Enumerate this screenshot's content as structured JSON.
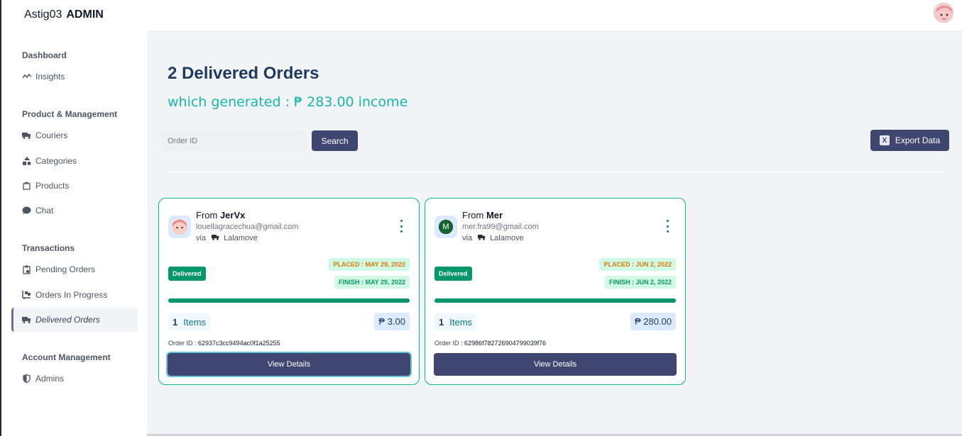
{
  "brand": {
    "name": "Astig03",
    "suffix": "ADMIN"
  },
  "sidebar": {
    "sections": [
      {
        "title": "Dashboard"
      },
      {
        "title": "Product & Management"
      },
      {
        "title": "Transactions"
      },
      {
        "title": "Account Management"
      }
    ],
    "items": [
      {
        "label": "Insights",
        "icon": "chart-line-icon"
      },
      {
        "label": "Couriers",
        "icon": "truck-icon"
      },
      {
        "label": "Categories",
        "icon": "shapes-icon"
      },
      {
        "label": "Products",
        "icon": "bag-icon"
      },
      {
        "label": "Chat",
        "icon": "chat-bubble-icon"
      },
      {
        "label": "Pending Orders",
        "icon": "clipboard-icon"
      },
      {
        "label": "Orders In Progress",
        "icon": "dolly-icon"
      },
      {
        "label": "Delivered Orders",
        "icon": "truck-icon",
        "active": true
      },
      {
        "label": "Admins",
        "icon": "shield-icon"
      }
    ]
  },
  "main": {
    "title": "2 Delivered Orders",
    "income_prefix": "which generated : ",
    "income_amount": "₱ 283.00",
    "income_suffix": " income",
    "search_placeholder": "Order ID",
    "search_label": "Search",
    "export_label": "Export Data"
  },
  "orders": [
    {
      "from_label": "From ",
      "name": "JerVx",
      "email": "louellagracechua@gmail.com",
      "via_label": "via",
      "courier": "Lalamove",
      "status": "Delivered",
      "placed": "PLACED : MAY 29, 2022",
      "finish": "FINISH : MAY 29, 2022",
      "progress": 1.0,
      "item_count": "1",
      "items_label": "Items",
      "price": "₱ 3.00",
      "order_id_label": "Order ID : ",
      "order_id": "62937c3cc9494ac0f1a25255",
      "view_label": "View Details"
    },
    {
      "from_label": "From ",
      "name": "Mer",
      "initial": "M",
      "email": "mer.fra99@gmail.com",
      "via_label": "via",
      "courier": "Lalamove",
      "status": "Delivered",
      "placed": "PLACED : JUN 2, 2022",
      "finish": "FINISH : JUN 2, 2022",
      "progress": 1.0,
      "item_count": "1",
      "items_label": "Items",
      "price": "₱ 280.00",
      "order_id_label": "Order ID : ",
      "order_id": "62986f782726904799039f76",
      "view_label": "View Details"
    }
  ],
  "colors": {
    "primary": "#3f4771",
    "accent": "#14b8a6",
    "success": "#059669",
    "warning": "#d97706"
  }
}
